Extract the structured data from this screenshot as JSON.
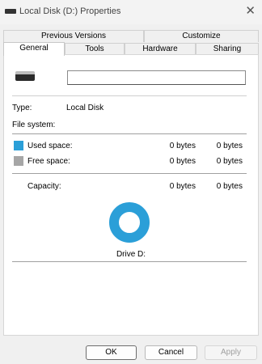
{
  "window": {
    "title": "Local Disk (D:) Properties",
    "close_glyph": "✕"
  },
  "tabs": {
    "row1": [
      {
        "label": "Previous Versions"
      },
      {
        "label": "Customize"
      }
    ],
    "row2": [
      {
        "label": "General",
        "active": true
      },
      {
        "label": "Tools"
      },
      {
        "label": "Hardware"
      },
      {
        "label": "Sharing"
      }
    ]
  },
  "general": {
    "name_value": "",
    "type_label": "Type:",
    "type_value": "Local Disk",
    "filesystem_label": "File system:",
    "filesystem_value": "",
    "used_label": "Used space:",
    "used_bytes": "0 bytes",
    "used_size": "0 bytes",
    "free_label": "Free space:",
    "free_bytes": "0 bytes",
    "free_size": "0 bytes",
    "capacity_label": "Capacity:",
    "capacity_bytes": "0 bytes",
    "capacity_size": "0 bytes",
    "drive_label": "Drive D:",
    "used_color": "#2b9fd8",
    "free_color": "#a6a6a6",
    "used_fraction": 0
  },
  "buttons": {
    "ok": "OK",
    "cancel": "Cancel",
    "apply": "Apply"
  }
}
